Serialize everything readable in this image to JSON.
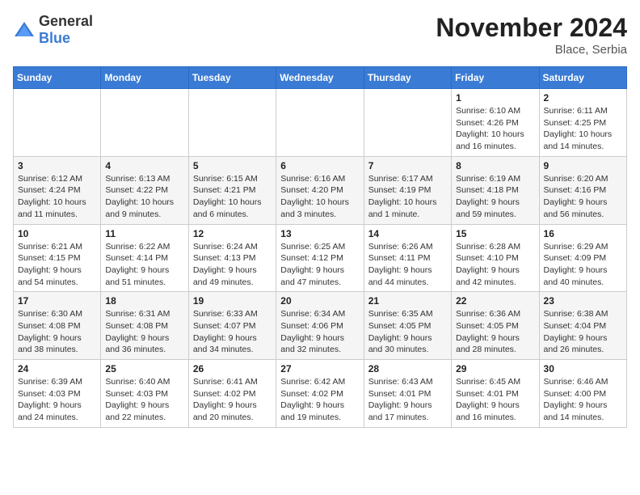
{
  "logo": {
    "general": "General",
    "blue": "Blue"
  },
  "title": "November 2024",
  "location": "Blace, Serbia",
  "days_header": [
    "Sunday",
    "Monday",
    "Tuesday",
    "Wednesday",
    "Thursday",
    "Friday",
    "Saturday"
  ],
  "weeks": [
    [
      {
        "day": "",
        "info": ""
      },
      {
        "day": "",
        "info": ""
      },
      {
        "day": "",
        "info": ""
      },
      {
        "day": "",
        "info": ""
      },
      {
        "day": "",
        "info": ""
      },
      {
        "day": "1",
        "info": "Sunrise: 6:10 AM\nSunset: 4:26 PM\nDaylight: 10 hours and 16 minutes."
      },
      {
        "day": "2",
        "info": "Sunrise: 6:11 AM\nSunset: 4:25 PM\nDaylight: 10 hours and 14 minutes."
      }
    ],
    [
      {
        "day": "3",
        "info": "Sunrise: 6:12 AM\nSunset: 4:24 PM\nDaylight: 10 hours and 11 minutes."
      },
      {
        "day": "4",
        "info": "Sunrise: 6:13 AM\nSunset: 4:22 PM\nDaylight: 10 hours and 9 minutes."
      },
      {
        "day": "5",
        "info": "Sunrise: 6:15 AM\nSunset: 4:21 PM\nDaylight: 10 hours and 6 minutes."
      },
      {
        "day": "6",
        "info": "Sunrise: 6:16 AM\nSunset: 4:20 PM\nDaylight: 10 hours and 3 minutes."
      },
      {
        "day": "7",
        "info": "Sunrise: 6:17 AM\nSunset: 4:19 PM\nDaylight: 10 hours and 1 minute."
      },
      {
        "day": "8",
        "info": "Sunrise: 6:19 AM\nSunset: 4:18 PM\nDaylight: 9 hours and 59 minutes."
      },
      {
        "day": "9",
        "info": "Sunrise: 6:20 AM\nSunset: 4:16 PM\nDaylight: 9 hours and 56 minutes."
      }
    ],
    [
      {
        "day": "10",
        "info": "Sunrise: 6:21 AM\nSunset: 4:15 PM\nDaylight: 9 hours and 54 minutes."
      },
      {
        "day": "11",
        "info": "Sunrise: 6:22 AM\nSunset: 4:14 PM\nDaylight: 9 hours and 51 minutes."
      },
      {
        "day": "12",
        "info": "Sunrise: 6:24 AM\nSunset: 4:13 PM\nDaylight: 9 hours and 49 minutes."
      },
      {
        "day": "13",
        "info": "Sunrise: 6:25 AM\nSunset: 4:12 PM\nDaylight: 9 hours and 47 minutes."
      },
      {
        "day": "14",
        "info": "Sunrise: 6:26 AM\nSunset: 4:11 PM\nDaylight: 9 hours and 44 minutes."
      },
      {
        "day": "15",
        "info": "Sunrise: 6:28 AM\nSunset: 4:10 PM\nDaylight: 9 hours and 42 minutes."
      },
      {
        "day": "16",
        "info": "Sunrise: 6:29 AM\nSunset: 4:09 PM\nDaylight: 9 hours and 40 minutes."
      }
    ],
    [
      {
        "day": "17",
        "info": "Sunrise: 6:30 AM\nSunset: 4:08 PM\nDaylight: 9 hours and 38 minutes."
      },
      {
        "day": "18",
        "info": "Sunrise: 6:31 AM\nSunset: 4:08 PM\nDaylight: 9 hours and 36 minutes."
      },
      {
        "day": "19",
        "info": "Sunrise: 6:33 AM\nSunset: 4:07 PM\nDaylight: 9 hours and 34 minutes."
      },
      {
        "day": "20",
        "info": "Sunrise: 6:34 AM\nSunset: 4:06 PM\nDaylight: 9 hours and 32 minutes."
      },
      {
        "day": "21",
        "info": "Sunrise: 6:35 AM\nSunset: 4:05 PM\nDaylight: 9 hours and 30 minutes."
      },
      {
        "day": "22",
        "info": "Sunrise: 6:36 AM\nSunset: 4:05 PM\nDaylight: 9 hours and 28 minutes."
      },
      {
        "day": "23",
        "info": "Sunrise: 6:38 AM\nSunset: 4:04 PM\nDaylight: 9 hours and 26 minutes."
      }
    ],
    [
      {
        "day": "24",
        "info": "Sunrise: 6:39 AM\nSunset: 4:03 PM\nDaylight: 9 hours and 24 minutes."
      },
      {
        "day": "25",
        "info": "Sunrise: 6:40 AM\nSunset: 4:03 PM\nDaylight: 9 hours and 22 minutes."
      },
      {
        "day": "26",
        "info": "Sunrise: 6:41 AM\nSunset: 4:02 PM\nDaylight: 9 hours and 20 minutes."
      },
      {
        "day": "27",
        "info": "Sunrise: 6:42 AM\nSunset: 4:02 PM\nDaylight: 9 hours and 19 minutes."
      },
      {
        "day": "28",
        "info": "Sunrise: 6:43 AM\nSunset: 4:01 PM\nDaylight: 9 hours and 17 minutes."
      },
      {
        "day": "29",
        "info": "Sunrise: 6:45 AM\nSunset: 4:01 PM\nDaylight: 9 hours and 16 minutes."
      },
      {
        "day": "30",
        "info": "Sunrise: 6:46 AM\nSunset: 4:00 PM\nDaylight: 9 hours and 14 minutes."
      }
    ]
  ]
}
